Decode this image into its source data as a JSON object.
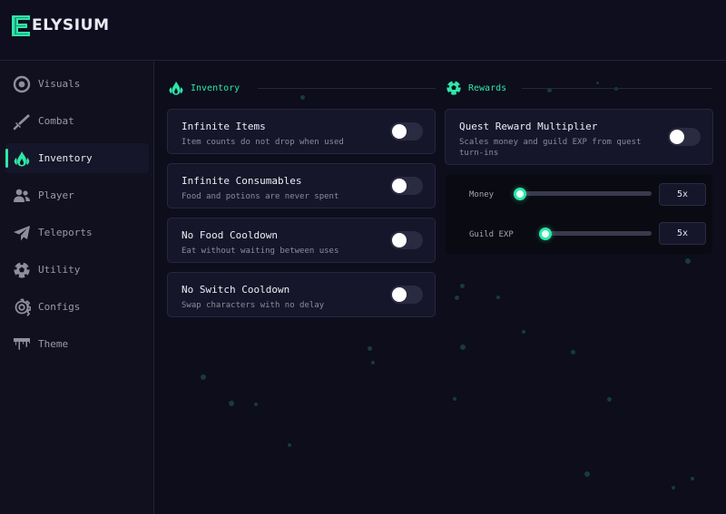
{
  "app": {
    "name": "ELYSIUM",
    "accent": "#2ee6a8"
  },
  "sidebar": {
    "items": [
      {
        "label": "Visuals",
        "icon": "eye-icon",
        "active": false
      },
      {
        "label": "Combat",
        "icon": "sword-icon",
        "active": false
      },
      {
        "label": "Inventory",
        "icon": "flame-icon",
        "active": true
      },
      {
        "label": "Player",
        "icon": "users-icon",
        "active": false
      },
      {
        "label": "Teleports",
        "icon": "paper-plane-icon",
        "active": false
      },
      {
        "label": "Utility",
        "icon": "soccer-ball-icon",
        "active": false
      },
      {
        "label": "Configs",
        "icon": "gear-icon",
        "active": false
      },
      {
        "label": "Theme",
        "icon": "paint-drip-icon",
        "active": false
      }
    ]
  },
  "inventory": {
    "title": "Inventory",
    "options": [
      {
        "title": "Infinite Items",
        "desc": "Item counts do not drop when used",
        "enabled": false
      },
      {
        "title": "Infinite Consumables",
        "desc": "Food and potions are never spent",
        "enabled": false
      },
      {
        "title": "No Food Cooldown",
        "desc": "Eat without waiting between uses",
        "enabled": false
      },
      {
        "title": "No Switch Cooldown",
        "desc": "Swap characters with no delay",
        "enabled": false
      }
    ]
  },
  "rewards": {
    "title": "Rewards",
    "option": {
      "title": "Quest Reward Multiplier",
      "desc_line1": "Scales money and guild EXP from quest",
      "desc_line2": "turn-ins",
      "enabled": false
    },
    "sliders": [
      {
        "label": "Money",
        "value": "5x"
      },
      {
        "label": "Guild EXP",
        "value": "5x"
      }
    ]
  }
}
